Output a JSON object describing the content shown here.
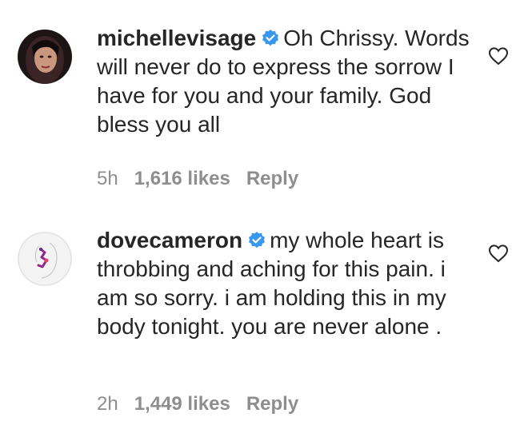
{
  "comments": [
    {
      "username": "michellevisage",
      "verified": true,
      "text": "Oh Chrissy. Words will never do to express the sorrow I have for you and your family. God bless you all",
      "time": "5h",
      "likes": "1,616 likes",
      "reply_label": "Reply"
    },
    {
      "username": "dovecameron",
      "verified": true,
      "text": "my whole heart is throbbing and aching for this pain. i am so sorry. i am holding this in my body tonight. you are never alone .",
      "time": "2h",
      "likes": "1,449 likes",
      "reply_label": "Reply"
    }
  ],
  "icons": {
    "verified": "verified-badge-icon",
    "like": "heart-outline-icon"
  },
  "colors": {
    "verified_blue": "#3897f0",
    "text": "#262626",
    "meta": "#8e8e8e"
  }
}
